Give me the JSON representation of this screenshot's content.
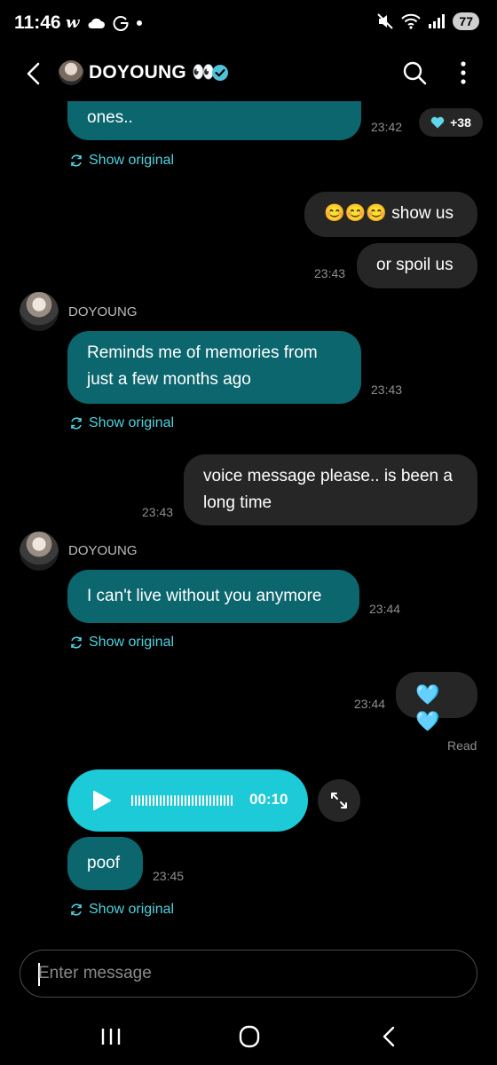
{
  "status_bar": {
    "time": "11:46",
    "battery": "77",
    "left_icons": [
      "w-app-icon",
      "cloud-icon",
      "google-icon",
      "dot-icon"
    ],
    "right_icons": [
      "mute-icon",
      "wifi-icon",
      "signal-icon"
    ]
  },
  "header": {
    "title": "DOYOUNG 👀",
    "verified": true
  },
  "messages": {
    "m1": {
      "text": "ones..",
      "time": "23:42",
      "reaction_count": "+38",
      "show_original": "Show original"
    },
    "m2": {
      "text": "😊😊😊 show us"
    },
    "m3": {
      "text": "or spoil us",
      "time": "23:43"
    },
    "m4": {
      "sender": "DOYOUNG",
      "text": "Reminds me of memories from just a few months ago",
      "time": "23:43",
      "show_original": "Show original"
    },
    "m5": {
      "text": "voice message please.. is been a long time",
      "time": "23:43"
    },
    "m6": {
      "sender": "DOYOUNG",
      "text": "I can't live without you anymore",
      "time": "23:44",
      "show_original": "Show original"
    },
    "m7": {
      "text": "🩵🩵",
      "time": "23:44",
      "status": "Read"
    },
    "m8": {
      "voice_duration": "00:10",
      "text": "poof",
      "time": "23:45",
      "show_original": "Show original"
    }
  },
  "input": {
    "placeholder": "Enter message"
  },
  "colors": {
    "incoming_bubble": "#0b666e",
    "outgoing_bubble": "#262626",
    "accent": "#4fd1de",
    "voice_player": "#1ccad8",
    "background": "#000000"
  }
}
